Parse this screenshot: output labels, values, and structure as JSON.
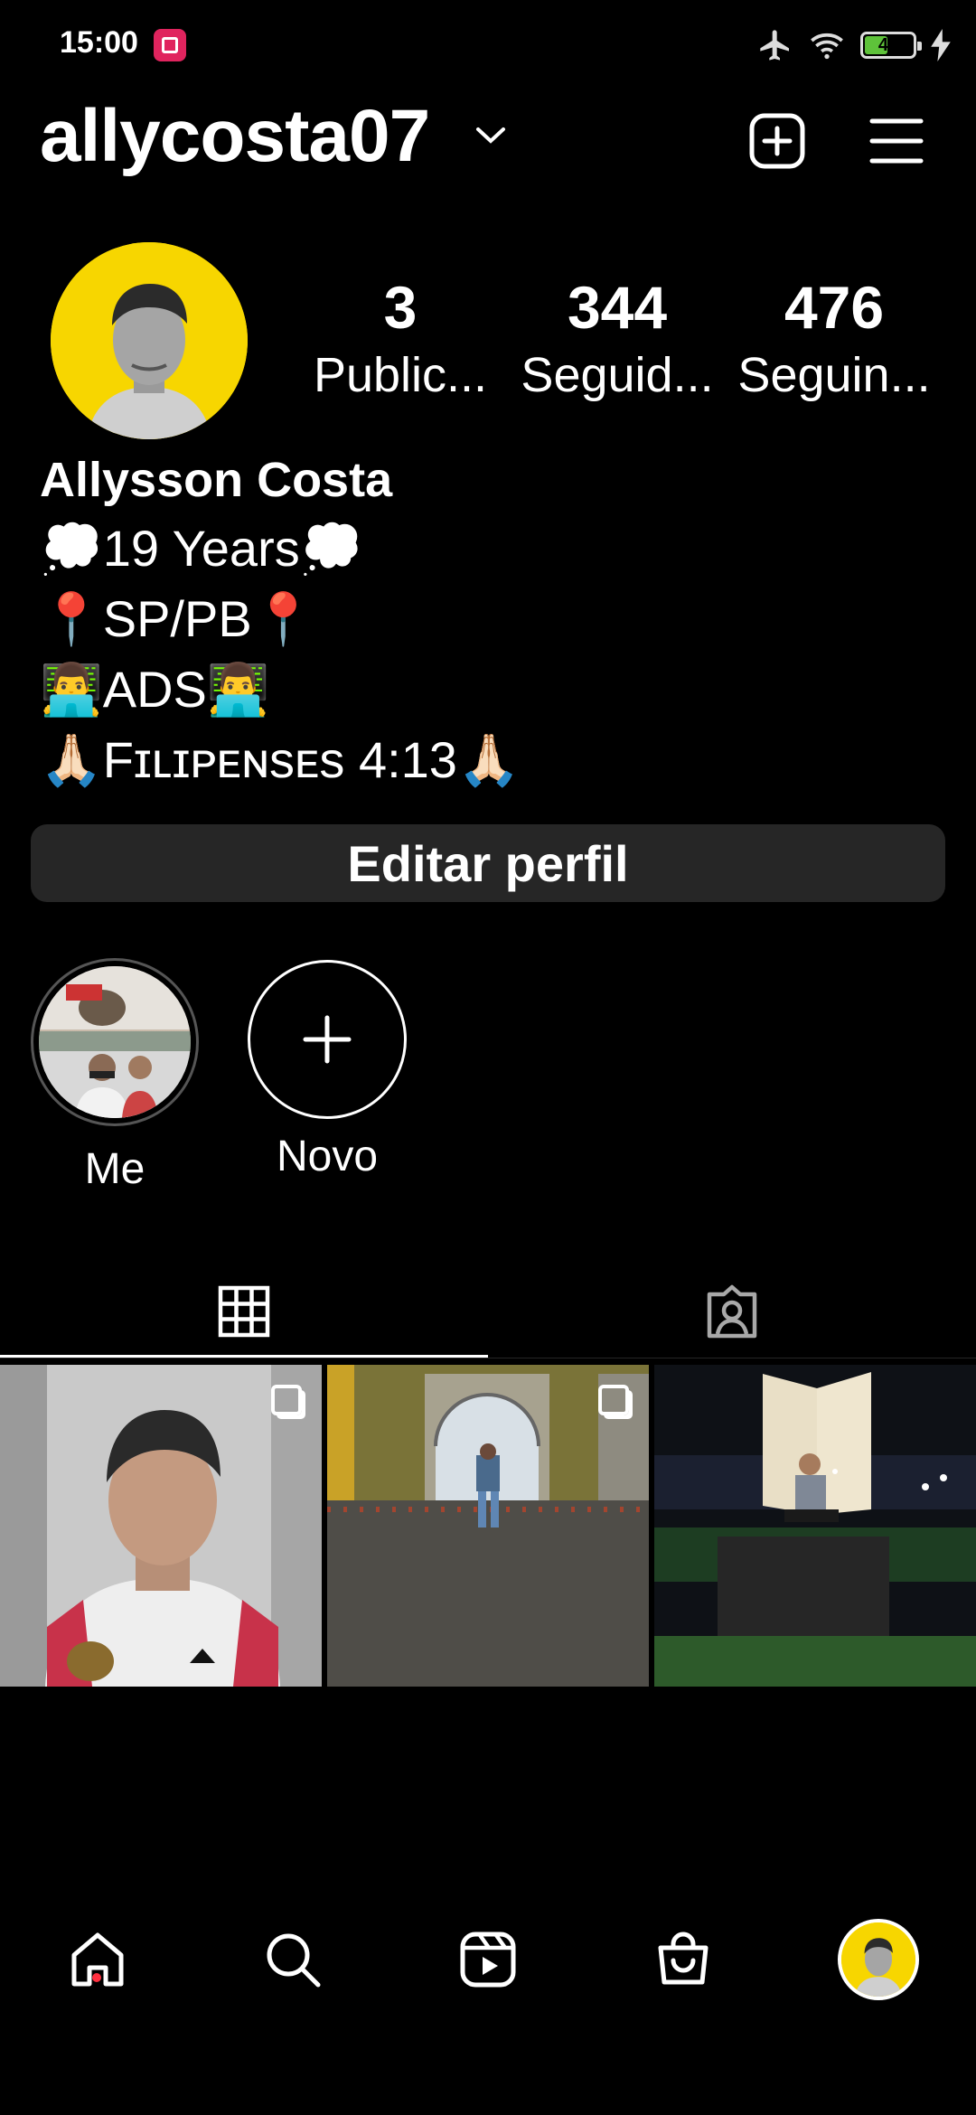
{
  "status_bar": {
    "time": "15:00",
    "battery": "42"
  },
  "header": {
    "username": "allycosta07"
  },
  "profile": {
    "stats": [
      {
        "value": "3",
        "label": "Public..."
      },
      {
        "value": "344",
        "label": "Seguid..."
      },
      {
        "value": "476",
        "label": "Seguin..."
      }
    ],
    "name": "Allysson Costa",
    "bio": [
      "💭19 Years💭",
      "📍SP/PB📍",
      "👨‍💻ADS👨‍💻",
      "🙏🏻Fɪʟɪᴘᴇɴsᴇs 4:13🙏🏻"
    ],
    "edit_button": "Editar perfil"
  },
  "highlights": [
    {
      "label": "Me"
    },
    {
      "label": "Novo"
    }
  ],
  "icons": {
    "new_post": "plus-square-icon",
    "menu": "hamburger-menu-icon",
    "grid_tab": "grid-icon",
    "tagged_tab": "tagged-person-icon",
    "nav": [
      "home-icon",
      "search-icon",
      "reels-icon",
      "shop-icon",
      "profile-avatar"
    ]
  },
  "colors": {
    "accent_dot": "#ff3040",
    "avatar_bg": "#f7d600",
    "button_bg": "#262626"
  }
}
